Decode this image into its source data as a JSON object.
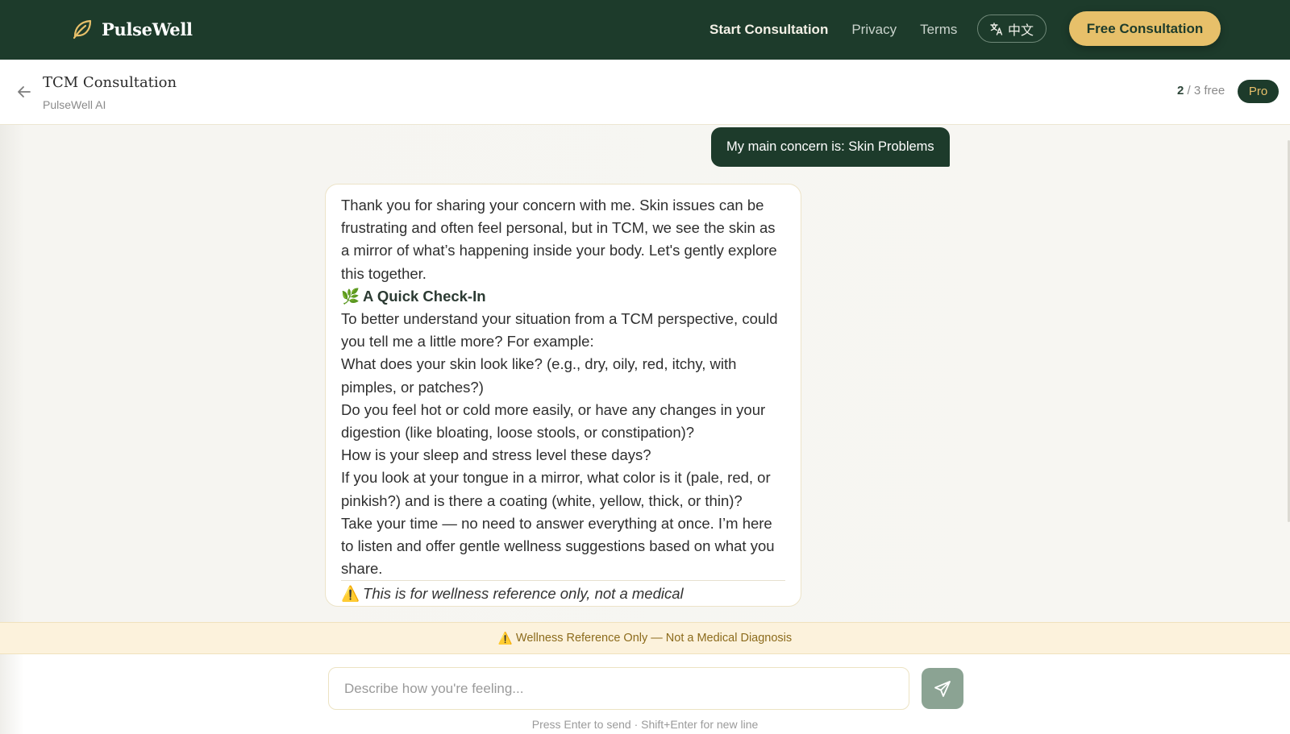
{
  "nav": {
    "brand": "PulseWell",
    "brand_icon": "leaf-icon",
    "links": [
      "Start Consultation",
      "Privacy",
      "Terms"
    ],
    "lang_label": "中文",
    "lang_icon": "translate-icon",
    "cta": "Free Consultation"
  },
  "header": {
    "title": "TCM Consultation",
    "subtitle": "PulseWell AI",
    "quota_used": "2",
    "quota_rest": " / 3 free",
    "badge": "Pro"
  },
  "chat": {
    "user_message": "My main concern is: Skin Problems",
    "bot_paragraphs": [
      "Thank you for sharing your concern with me. Skin issues can be frustrating and often feel personal, but in TCM, we see the skin as a mirror of what’s happening inside your body. Let's gently explore this together."
    ],
    "bot_heading_emoji": "🌿",
    "bot_heading": "A Quick Check-In",
    "bot_body": [
      "To better understand your situation from a TCM perspective, could you tell me a little more? For example:",
      "What does your skin look like? (e.g., dry, oily, red, itchy, with pimples, or patches?)",
      "Do you feel hot or cold more easily, or have any changes in your digestion (like bloating, loose stools, or constipation)?",
      "How is your sleep and stress level these days?",
      "If you look at your tongue in a mirror, what color is it (pale, red, or pinkish?) and is there a coating (white, yellow, thick, or thin)?",
      "Take your time — no need to answer everything at once. I’m here to listen and offer gentle wellness suggestions based on what you share."
    ],
    "disclaimer_emoji": "⚠️",
    "disclaimer": "This is for wellness reference only, not a medical"
  },
  "banner": {
    "icon": "⚠️",
    "text": "Wellness Reference Only — Not a Medical Diagnosis"
  },
  "composer": {
    "placeholder": "Describe how you're feeling...",
    "send_icon": "send-icon",
    "hint": "Press Enter to send · Shift+Enter for new line"
  }
}
